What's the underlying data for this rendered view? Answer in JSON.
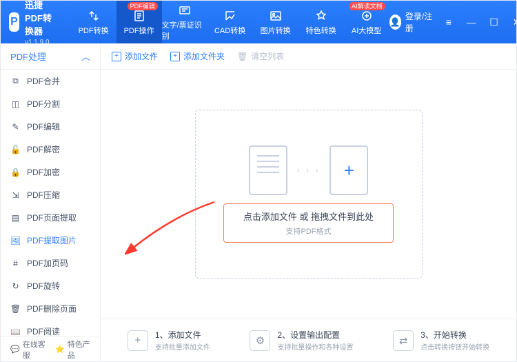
{
  "app": {
    "name": "迅捷PDF转换器",
    "version": "v1.1.9.0"
  },
  "topnav": [
    {
      "label": "PDF转换",
      "badge": null
    },
    {
      "label": "PDF操作",
      "badge": "PDF编辑",
      "active": true
    },
    {
      "label": "文字/票证识别",
      "badge": null
    },
    {
      "label": "CAD转换",
      "badge": null
    },
    {
      "label": "图片转换",
      "badge": null
    },
    {
      "label": "特色转换",
      "badge": null
    },
    {
      "label": "AI大模型",
      "badge": "AI解读文档"
    }
  ],
  "login": {
    "label": "登录/注册"
  },
  "sidebar": {
    "header": "PDF处理",
    "items": [
      {
        "label": "PDF合并",
        "icon": "merge"
      },
      {
        "label": "PDF分割",
        "icon": "split"
      },
      {
        "label": "PDF编辑",
        "icon": "edit"
      },
      {
        "label": "PDF解密",
        "icon": "unlock"
      },
      {
        "label": "PDF加密",
        "icon": "lock"
      },
      {
        "label": "PDF压缩",
        "icon": "compress"
      },
      {
        "label": "PDF页面提取",
        "icon": "page"
      },
      {
        "label": "PDF提取图片",
        "icon": "image",
        "active": true
      },
      {
        "label": "PDF加页码",
        "icon": "number"
      },
      {
        "label": "PDF旋转",
        "icon": "rotate"
      },
      {
        "label": "PDF删除页面",
        "icon": "delete"
      },
      {
        "label": "PDF阅读",
        "icon": "read"
      }
    ],
    "footer": {
      "support": "在线客服",
      "featured": "特色产品"
    }
  },
  "toolbar": {
    "add_file": "添加文件",
    "add_folder": "添加文件夹",
    "clear": "清空列表"
  },
  "drop": {
    "main": "点击添加文件 或 拖拽文件到此处",
    "sub": "支持PDF格式"
  },
  "steps": [
    {
      "num": "1、",
      "title": "添加文件",
      "desc": "支持批量添加文件"
    },
    {
      "num": "2、",
      "title": "设置输出配置",
      "desc": "支持批量操作和各种设置"
    },
    {
      "num": "3、",
      "title": "开始转换",
      "desc": "点击转换按钮开始转换"
    }
  ]
}
